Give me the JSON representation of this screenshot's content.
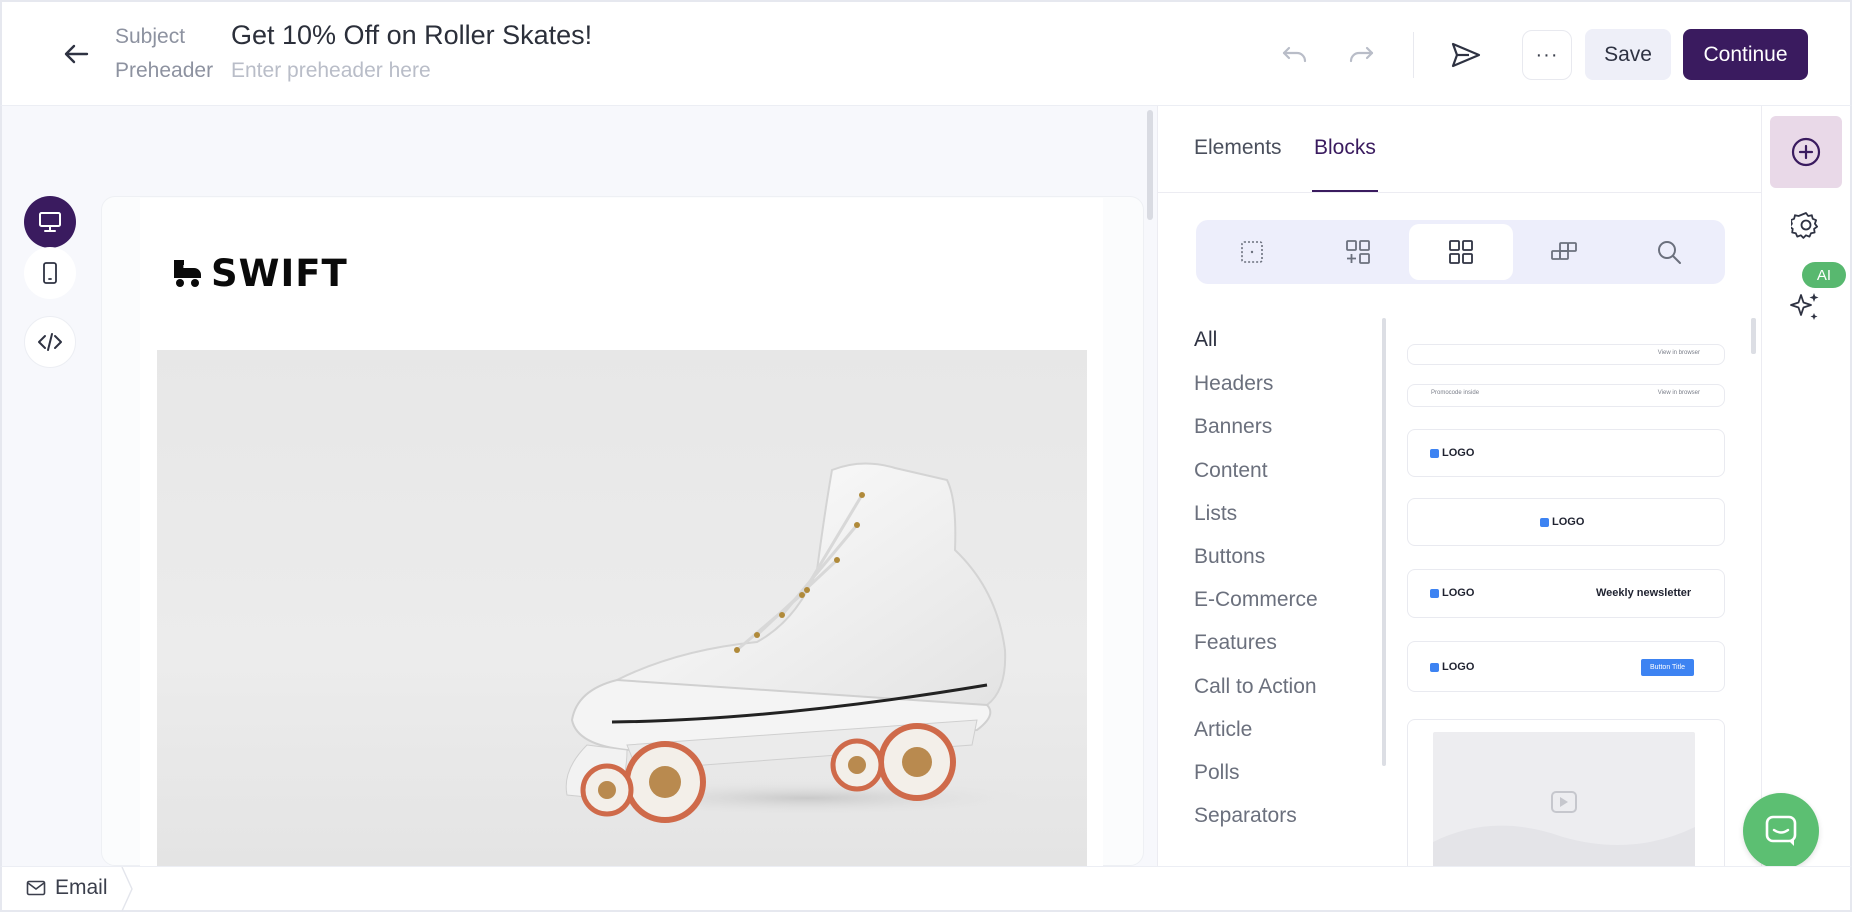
{
  "header": {
    "subject_label": "Subject",
    "subject_value": "Get 10% Off on Roller Skates!",
    "preheader_label": "Preheader",
    "preheader_value": "",
    "preheader_placeholder": "Enter preheader here",
    "more_label": "···",
    "save_label": "Save",
    "continue_label": "Continue"
  },
  "email": {
    "logo_text": "SWIFT"
  },
  "panel": {
    "tabs": [
      {
        "label": "Elements",
        "active": false
      },
      {
        "label": "Blocks",
        "active": true
      }
    ],
    "categories": [
      "All",
      "Headers",
      "Banners",
      "Content",
      "Lists",
      "Buttons",
      "E-Commerce",
      "Features",
      "Call to Action",
      "Article",
      "Polls",
      "Separators"
    ],
    "blocks": {
      "view_in_browser": "View in browser",
      "promocode_inside": "Promocode inside",
      "logo": "LOGO",
      "weekly_newsletter": "Weekly newsletter",
      "button_title": "Button Title"
    }
  },
  "rail": {
    "ai_badge": "AI"
  },
  "footer": {
    "breadcrumb": "Email"
  },
  "colors": {
    "brand": "#3a1b5f",
    "accent_green": "#5cbf72",
    "block_blue": "#3d83f2"
  }
}
